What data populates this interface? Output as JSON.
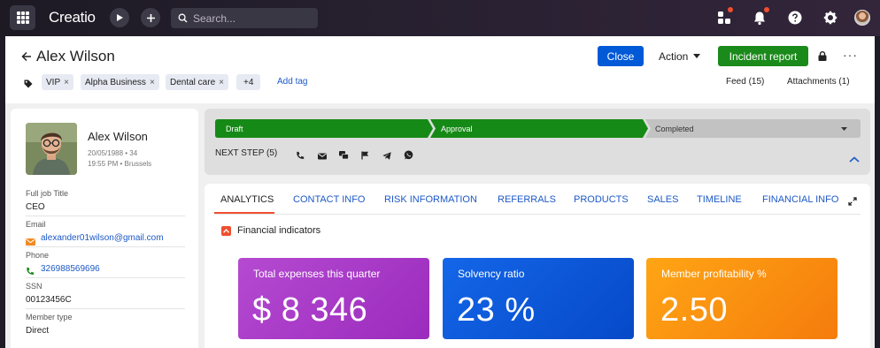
{
  "topbar": {
    "logo": "Creatio",
    "search_placeholder": "Search..."
  },
  "record": {
    "title": "Alex Wilson",
    "close_label": "Close",
    "action_label": "Action",
    "incident_label": "Incident report",
    "tags": [
      "VIP",
      "Alpha Business",
      "Dental care"
    ],
    "more_tags": "+4",
    "add_tag": "Add tag",
    "feed": "Feed (15)",
    "attachments": "Attachments (1)"
  },
  "contact": {
    "name": "Alex Wilson",
    "birth": "20/05/1988 • 34",
    "local_time": "19:55 PM • Brussels",
    "fields": {
      "job_label": "Full job Title",
      "job_value": "CEO",
      "email_label": "Email",
      "email_value": "alexander01wilson@gmail.com",
      "phone_label": "Phone",
      "phone_value": "326988569696",
      "ssn_label": "SSN",
      "ssn_value": "00123456C",
      "type_label": "Member type",
      "type_value": "Direct"
    }
  },
  "stages": {
    "items": [
      "Draft",
      "Approval",
      "Completed"
    ],
    "next_step": "NEXT STEP (5)",
    "colors": {
      "done": "#168a16",
      "pending": "#c2c2c2"
    }
  },
  "tabs": [
    "ANALYTICS",
    "CONTACT INFO",
    "RISK INFORMATION",
    "REFERRALS",
    "PRODUCTS",
    "SALES",
    "TIMELINE",
    "FINANCIAL INFO"
  ],
  "financial": {
    "section_label": "Financial indicators",
    "cards": [
      {
        "title": "Total expenses this quarter",
        "value": "$ 8 346"
      },
      {
        "title": "Solvency ratio",
        "value": "23 %"
      },
      {
        "title": "Member profitability %",
        "value": "2.50"
      }
    ]
  },
  "colors": {
    "primary": "#0059d6",
    "success": "#1a8a1a",
    "accent": "#f04e2f"
  }
}
